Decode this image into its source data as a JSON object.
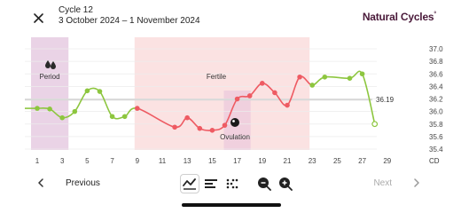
{
  "header": {
    "cycle_title": "Cycle 12",
    "cycle_dates": "3 October 2024 – 1 November 2024",
    "brand": "Natural Cycles",
    "brand_mark": "°"
  },
  "chart": {
    "labels": {
      "period": "Period",
      "fertile": "Fertile",
      "ovulation": "Ovulation",
      "coverline": "36.19",
      "unit": "CD"
    },
    "colors": {
      "period_bg": "#ead3e6",
      "fertile_bg": "#fbe2e2",
      "ovulation_bg": "#f0d0de",
      "infertile": "#8dc63f",
      "fertile_line": "#ee5b63",
      "coverline": "#d8d8d8"
    }
  },
  "chart_data": {
    "type": "line",
    "x": [
      1,
      2,
      3,
      4,
      5,
      6,
      7,
      8,
      9,
      12,
      13,
      14,
      15,
      16,
      17,
      18,
      19,
      20,
      21,
      22,
      23,
      24,
      26,
      27,
      28
    ],
    "y": [
      36.05,
      36.04,
      35.9,
      36.0,
      36.33,
      36.32,
      35.92,
      35.92,
      36.05,
      35.75,
      35.9,
      35.73,
      35.7,
      35.78,
      36.2,
      36.25,
      36.45,
      36.3,
      36.1,
      36.55,
      36.42,
      36.55,
      36.53,
      36.6,
      35.8
    ],
    "point_status": [
      "green",
      "green",
      "green",
      "green",
      "green",
      "green",
      "green",
      "green",
      "red",
      "red",
      "red",
      "red",
      "red",
      "red",
      "red",
      "red",
      "red",
      "red",
      "red",
      "red",
      "green",
      "green",
      "green",
      "green",
      "green"
    ],
    "xticks": [
      "1",
      "3",
      "5",
      "7",
      "9",
      "11",
      "13",
      "15",
      "17",
      "19",
      "21",
      "23",
      "25",
      "27",
      "29"
    ],
    "yticks": [
      "37.0",
      "36.8",
      "36.6",
      "36.4",
      "36.2",
      "36.0",
      "35.8",
      "35.6",
      "35.4"
    ],
    "xlim": [
      1,
      30
    ],
    "ylim": [
      35.4,
      37.0
    ],
    "coverline": 36.19,
    "period_days": [
      1,
      3
    ],
    "fertile_days": [
      9,
      23
    ],
    "ovulation_day": 16.5,
    "ovulation_range": [
      16,
      17
    ],
    "xlabel": "CD",
    "grid": true
  },
  "footer": {
    "prev_label": "Previous",
    "next_label": "Next",
    "icons": [
      "line-chart-icon",
      "bars-icon",
      "dots-grid-icon",
      "zoom-out-icon",
      "zoom-in-icon"
    ]
  }
}
